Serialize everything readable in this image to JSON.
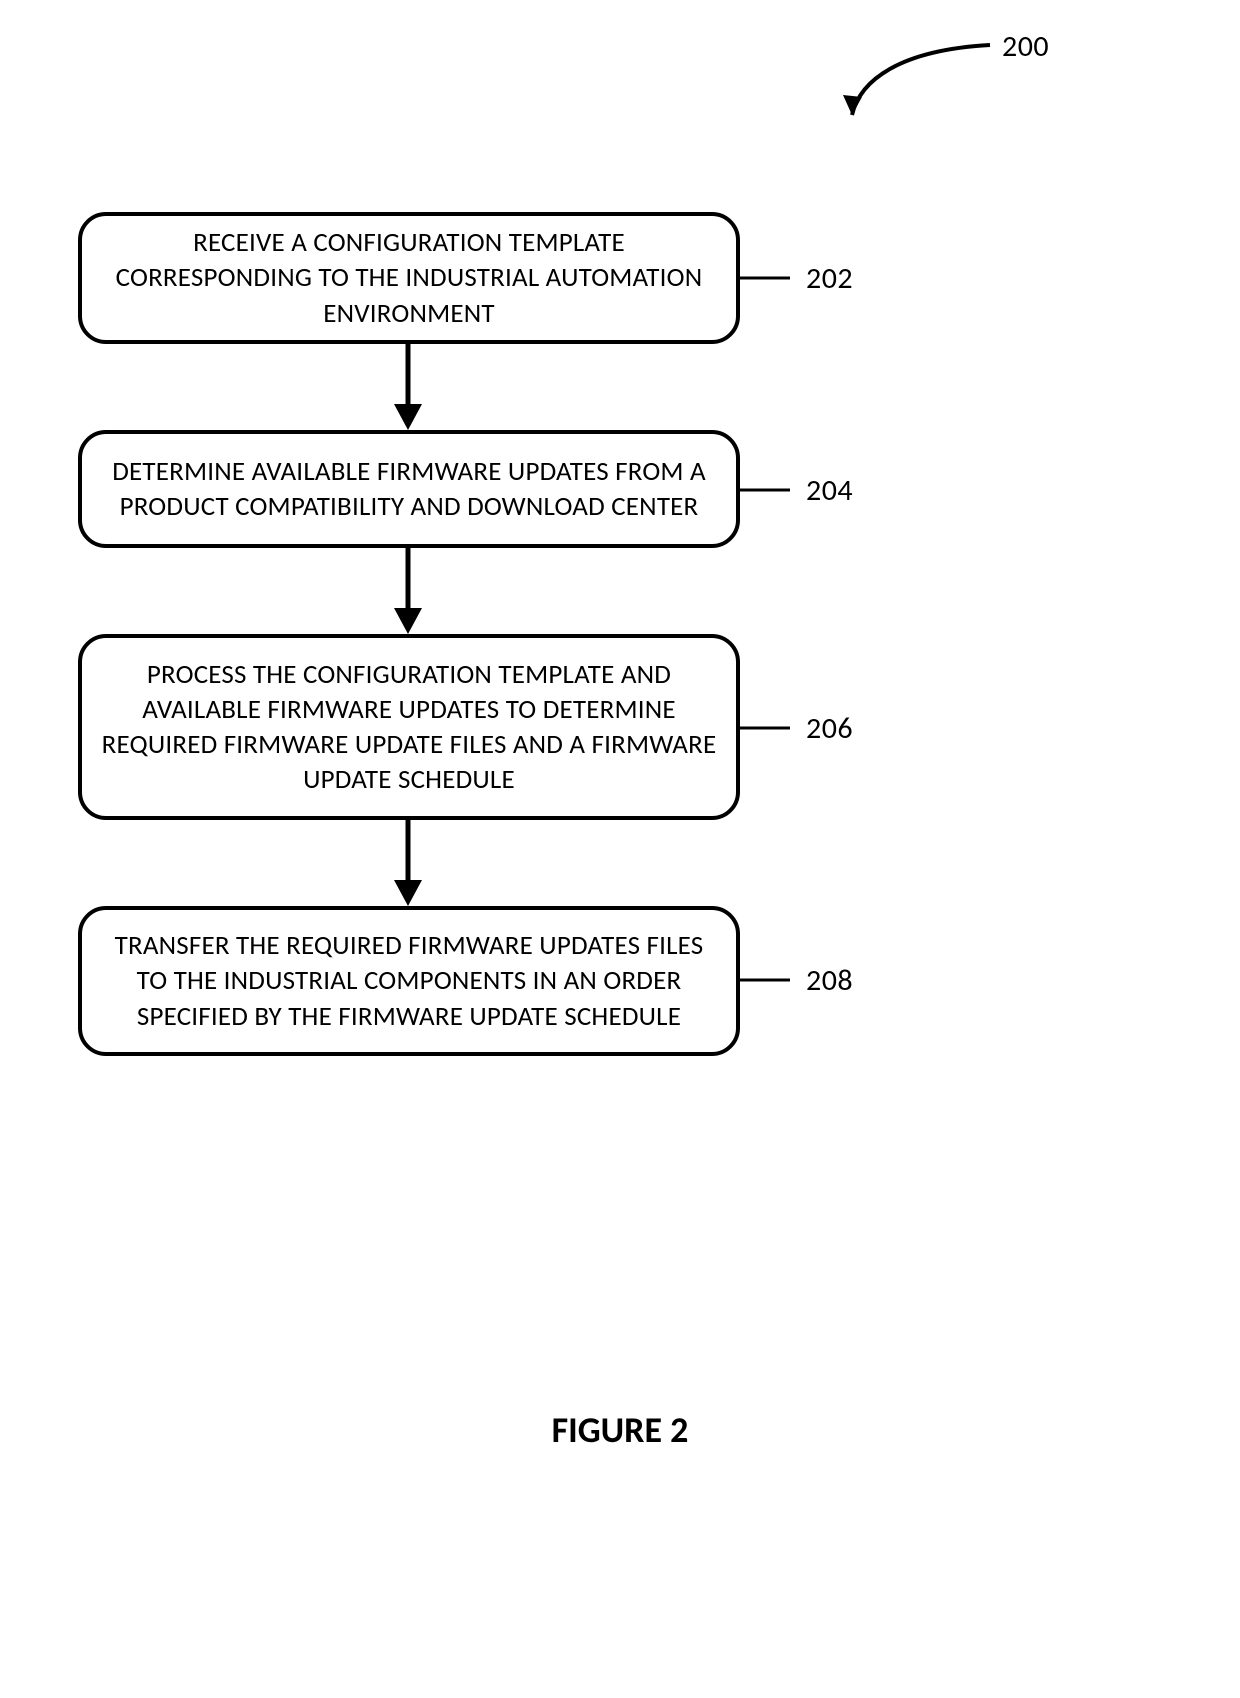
{
  "figure_ref": "200",
  "caption": "FIGURE 2",
  "steps": [
    {
      "ref": "202",
      "text": "RECEIVE A CONFIGURATION TEMPLATE CORRESPONDING TO THE INDUSTRIAL AUTOMATION ENVIRONMENT"
    },
    {
      "ref": "204",
      "text": "DETERMINE AVAILABLE FIRMWARE UPDATES FROM A PRODUCT COMPATIBILITY AND DOWNLOAD CENTER"
    },
    {
      "ref": "206",
      "text": "PROCESS THE CONFIGURATION TEMPLATE AND AVAILABLE FIRMWARE UPDATES TO DETERMINE REQUIRED FIRMWARE UPDATE FILES AND A FIRMWARE UPDATE SCHEDULE"
    },
    {
      "ref": "208",
      "text": "TRANSFER THE REQUIRED FIRMWARE UPDATES FILES TO THE INDUSTRIAL COMPONENTS IN AN ORDER SPECIFIED BY THE FIRMWARE UPDATE SCHEDULE"
    }
  ]
}
